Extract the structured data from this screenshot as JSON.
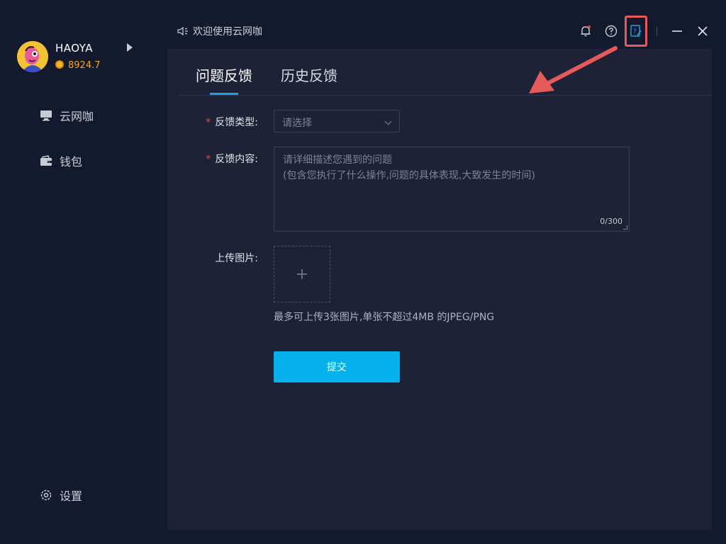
{
  "user": {
    "name": "HAOYA",
    "coins": "8924.7"
  },
  "sidebar": {
    "items": [
      {
        "label": "云网咖",
        "icon": "monitor-icon"
      },
      {
        "label": "钱包",
        "icon": "wallet-icon"
      }
    ],
    "settings_label": "设置"
  },
  "titlebar": {
    "welcome": "欢迎使用云网咖",
    "icons": [
      "bell-icon",
      "help-icon",
      "feedback-icon",
      "minimize-icon",
      "close-icon"
    ]
  },
  "tabs": [
    {
      "label": "问题反馈",
      "active": true
    },
    {
      "label": "历史反馈",
      "active": false
    }
  ],
  "form": {
    "type_label": "反馈类型:",
    "type_placeholder": "请选择",
    "content_label": "反馈内容:",
    "content_placeholder_line1": "请详细描述您遇到的问题",
    "content_placeholder_line2": "(包含您执行了什么操作,问题的具体表现,大致发生的时间)",
    "counter": "0/300",
    "upload_label": "上传图片:",
    "upload_plus": "+",
    "upload_hint": "最多可上传3张图片,单张不超过4MB 的JPEG/PNG",
    "submit_label": "提交",
    "required_mark": "*"
  },
  "colors": {
    "background": "#141a2e",
    "panel": "#1d2236",
    "accent": "#05b0eb",
    "tab_underline": "#1ea0e6",
    "required": "#e64545",
    "annotation": "#e65a5a",
    "coin": "#f5a623"
  }
}
